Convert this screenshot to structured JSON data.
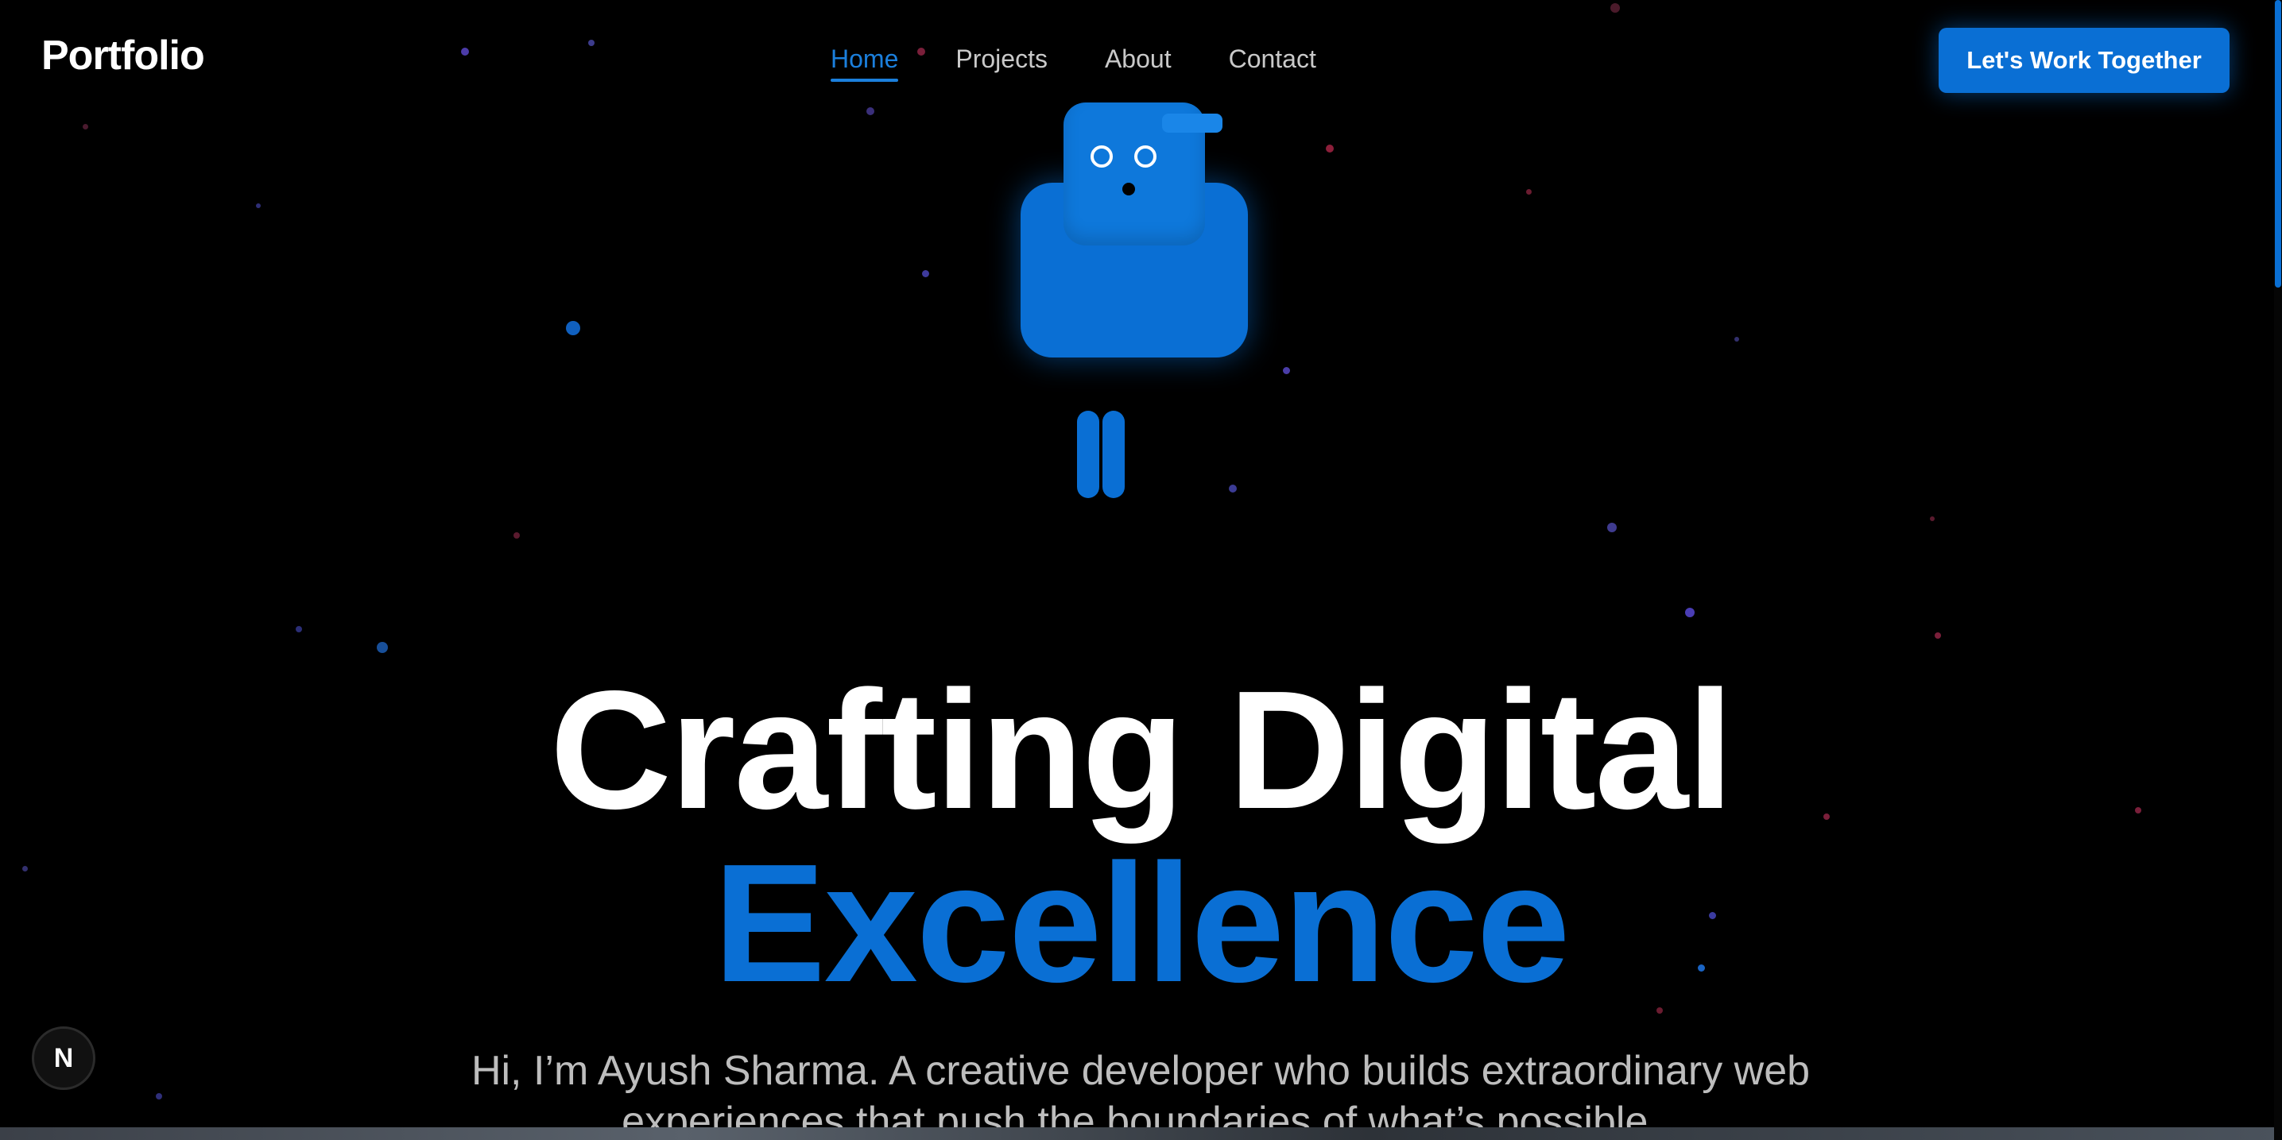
{
  "header": {
    "brand": "Portfolio",
    "nav": [
      {
        "label": "Home",
        "active": true
      },
      {
        "label": "Projects",
        "active": false
      },
      {
        "label": "About",
        "active": false
      },
      {
        "label": "Contact",
        "active": false
      }
    ],
    "cta_label": "Let's Work Together"
  },
  "hero": {
    "headline_line1": "Crafting Digital",
    "headline_line2": "Excellence",
    "intro": "Hi, I’m Ayush Sharma. A creative developer who builds extraordinary web experiences that push the boundaries of what’s possible."
  },
  "dev_badge": {
    "label": "N"
  },
  "colors": {
    "accent": "#0a6fd4",
    "background": "#000000",
    "text": "#ffffff",
    "muted_text": "#bdbdbd"
  },
  "icons": {
    "mascot": "robot-mascot",
    "dev_badge": "nextjs-logo-icon"
  }
}
